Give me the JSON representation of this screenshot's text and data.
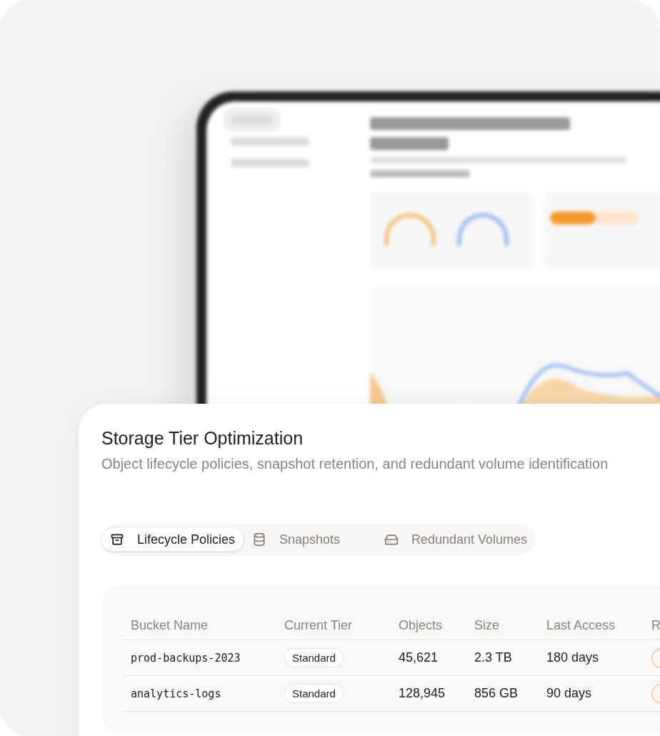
{
  "header": {
    "title": "Storage Tier Optimization",
    "subtitle": "Object lifecycle policies, snapshot retention, and redundant volume identification"
  },
  "tabs": [
    {
      "label": "Lifecycle Policies",
      "kind": "archive",
      "selected": true
    },
    {
      "label": "Snapshots",
      "kind": "database",
      "selected": false
    },
    {
      "label": "Redundant Volumes",
      "kind": "drive",
      "selected": false
    }
  ],
  "table": {
    "columns": [
      "Bucket Name",
      "Current Tier",
      "Objects",
      "Size",
      "Last Access",
      "R"
    ],
    "rows": [
      {
        "bucket": "prod-backups-2023",
        "tier": "Standard",
        "objects": "45,621",
        "size": "2.3 TB",
        "last_access": "180 days"
      },
      {
        "bucket": "analytics-logs",
        "tier": "Standard",
        "objects": "128,945",
        "size": "856 GB",
        "last_access": "90 days"
      }
    ]
  }
}
